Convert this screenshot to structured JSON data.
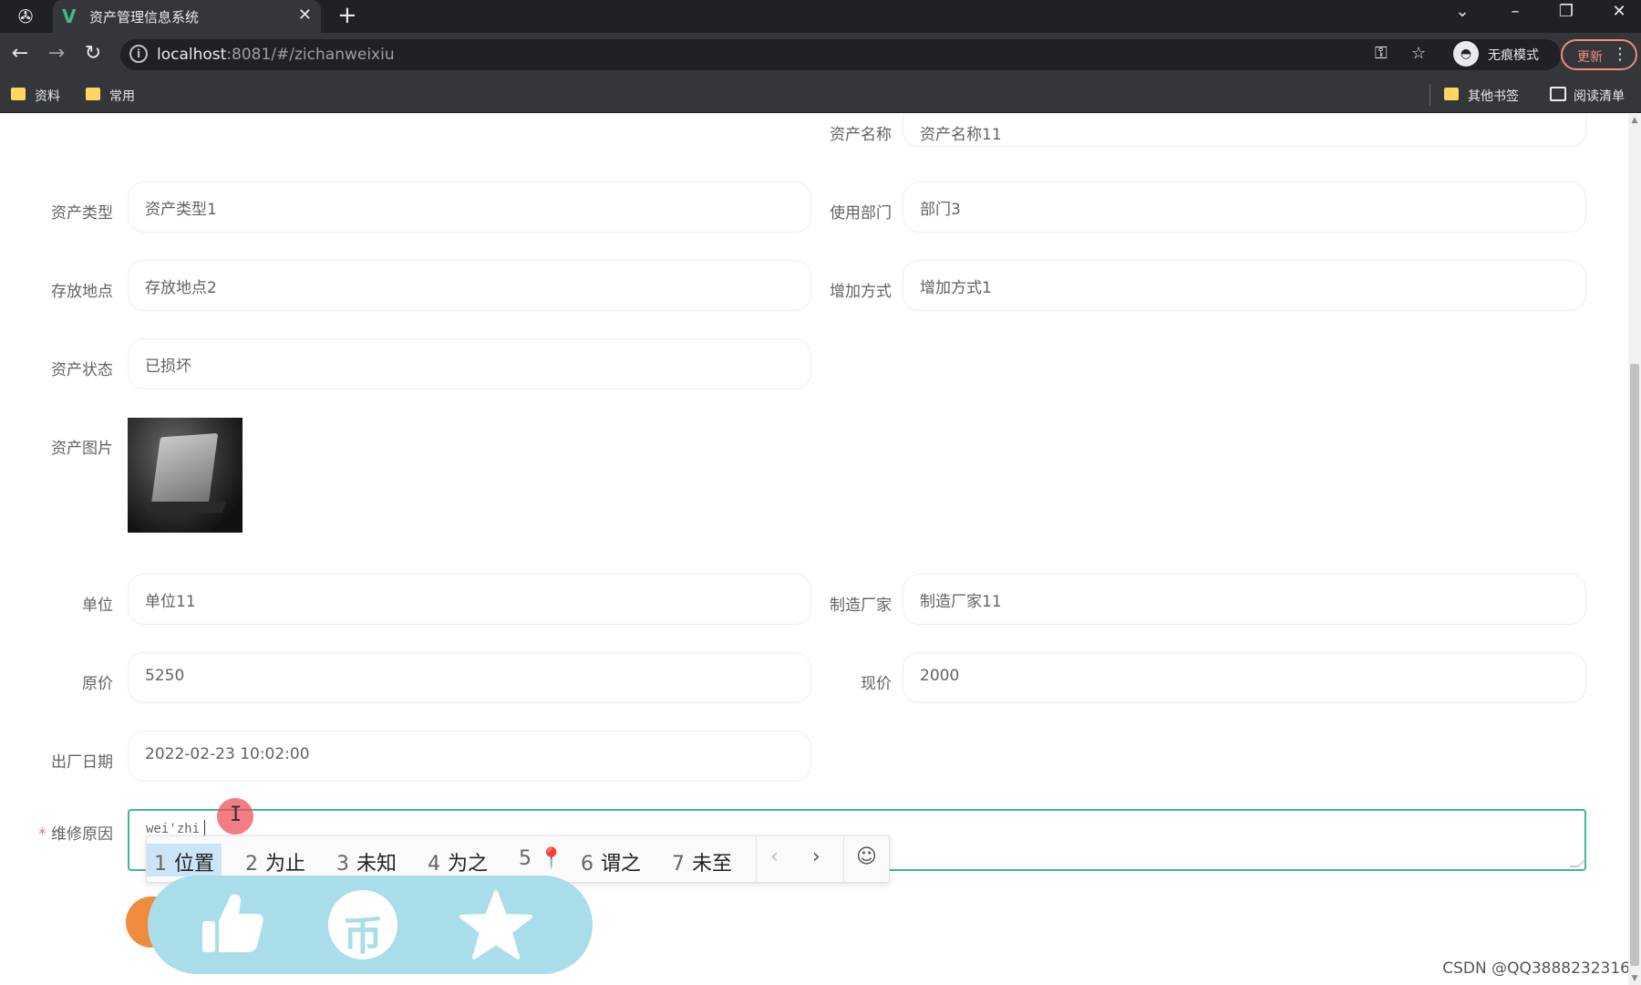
{
  "browser": {
    "tab_title": "资产管理信息系统",
    "url_host": "localhost",
    "url_rest": ":8081/#/zichanweixiu",
    "incognito_label": "无痕模式",
    "update_label": "更新",
    "bookmarks": [
      "资料",
      "常用"
    ],
    "other_bookmarks": "其他书签",
    "reading_list": "阅读清单"
  },
  "form": {
    "asset_name": {
      "label": "资产名称",
      "value": "资产名称11"
    },
    "asset_type": {
      "label": "资产类型",
      "value": "资产类型1"
    },
    "department": {
      "label": "使用部门",
      "value": "部门3"
    },
    "location": {
      "label": "存放地点",
      "value": "存放地点2"
    },
    "add_method": {
      "label": "增加方式",
      "value": "增加方式1"
    },
    "status": {
      "label": "资产状态",
      "value": "已损坏"
    },
    "image": {
      "label": "资产图片"
    },
    "unit": {
      "label": "单位",
      "value": "单位11"
    },
    "manufacturer": {
      "label": "制造厂家",
      "value": "制造厂家11"
    },
    "original_price": {
      "label": "原价",
      "value": "5250"
    },
    "current_price": {
      "label": "现价",
      "value": "2000"
    },
    "factory_date": {
      "label": "出厂日期",
      "value": "2022-02-23 10:02:00"
    },
    "repair_reason": {
      "label": "维修原因",
      "required_mark": "*",
      "ime_composition": "wei'zhi"
    }
  },
  "ime": {
    "candidates": [
      {
        "num": "1",
        "text": "位置"
      },
      {
        "num": "2",
        "text": "为止"
      },
      {
        "num": "3",
        "text": "未知"
      },
      {
        "num": "4",
        "text": "为之"
      },
      {
        "num": "5",
        "text": "📍"
      },
      {
        "num": "6",
        "text": "谓之"
      },
      {
        "num": "7",
        "text": "未至"
      }
    ],
    "prev": "‹",
    "next": "›",
    "emoji": "☺"
  },
  "reactions": {
    "like_icon": "thumbs-up-icon",
    "coin_icon": "coin-icon",
    "coin_mark": "币",
    "favorite_icon": "star-icon",
    "color": "#a8dde9"
  },
  "watermark": "CSDN @QQ3888232316",
  "colors": {
    "accent": "#3eb89b",
    "chrome_dark": "#202124",
    "chrome_toolbar": "#35363a"
  }
}
